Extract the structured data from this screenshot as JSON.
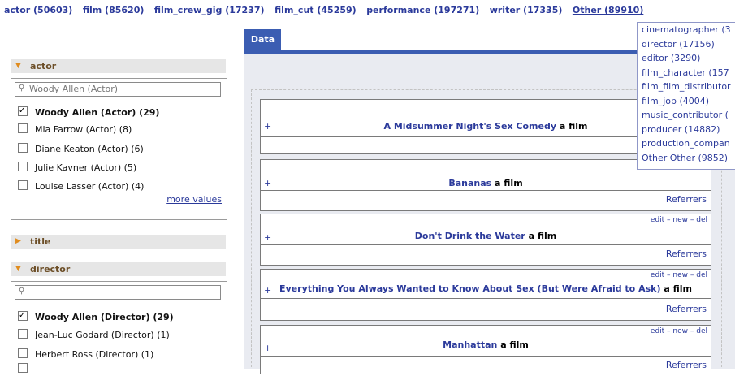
{
  "topnav": {
    "items": [
      "actor (50603)",
      "film (85620)",
      "film_crew_gig (17237)",
      "film_cut (45259)",
      "performance (197271)",
      "writer (17335)"
    ],
    "other": "Other (89910)"
  },
  "dropdown": {
    "items": [
      "cinematographer (3",
      "director (17156)",
      "editor (3290)",
      "film_character (157",
      "film_film_distributor",
      "film_job (4004)",
      "music_contributor (",
      "producer (14882)",
      "production_compan",
      "Other Other (9852)"
    ]
  },
  "facets": {
    "actor": {
      "label": "actor",
      "search_placeholder": "Woody Allen (Actor)",
      "values": [
        "Woody Allen (Actor) (29)",
        "Mia Farrow (Actor) (8)",
        "Diane Keaton (Actor) (6)",
        "Julie Kavner (Actor) (5)",
        "Louise Lasser (Actor) (4)"
      ],
      "more": "more values"
    },
    "title": {
      "label": "title"
    },
    "director": {
      "label": "director",
      "values": [
        "Woody Allen (Director) (29)",
        "Jean-Luc Godard (Director) (1)",
        "Herbert Ross (Director) (1)"
      ]
    }
  },
  "main": {
    "tab": "Data",
    "actions": "edit – new – del",
    "plus": "+",
    "kind": "a film",
    "referrers": "Referrers",
    "records": [
      "A Midsummer Night's Sex Comedy",
      "Bananas",
      "Don't Drink the Water",
      "Everything You Always Wanted to Know About Sex (But Were Afraid to Ask)",
      "Manhattan"
    ]
  },
  "colors": {
    "accent": "#3b5db2",
    "link": "#2b3a9b",
    "facet_label": "#6c4e27",
    "triangle": "#e08c1e"
  }
}
